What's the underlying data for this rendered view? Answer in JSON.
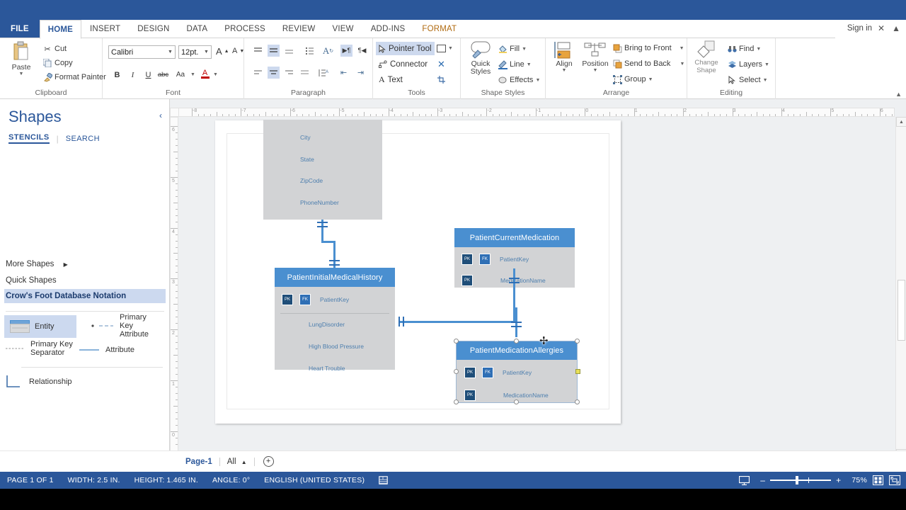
{
  "app": {
    "signin_label": "Sign in"
  },
  "ribbon": {
    "tabs": [
      {
        "label": "FILE",
        "kind": "file"
      },
      {
        "label": "HOME",
        "kind": "active"
      },
      {
        "label": "INSERT",
        "kind": "normal"
      },
      {
        "label": "DESIGN",
        "kind": "normal"
      },
      {
        "label": "DATA",
        "kind": "normal"
      },
      {
        "label": "PROCESS",
        "kind": "normal"
      },
      {
        "label": "REVIEW",
        "kind": "normal"
      },
      {
        "label": "VIEW",
        "kind": "normal"
      },
      {
        "label": "ADD-INS",
        "kind": "normal"
      },
      {
        "label": "FORMAT",
        "kind": "contextual"
      }
    ],
    "groups": {
      "clipboard": {
        "title": "Clipboard",
        "paste": "Paste",
        "cut": "Cut",
        "copy": "Copy",
        "format_painter": "Format Painter"
      },
      "font": {
        "title": "Font",
        "font_name": "Calibri",
        "font_size": "12pt.",
        "grow": "A",
        "shrink": "A",
        "bold": "B",
        "italic": "I",
        "underline": "U",
        "strikethrough": "abc",
        "change_case": "Aa",
        "font_color": "A"
      },
      "paragraph": {
        "title": "Paragraph"
      },
      "tools": {
        "title": "Tools",
        "pointer_tool": "Pointer Tool",
        "connector": "Connector",
        "text": "Text"
      },
      "shape_styles": {
        "title": "Shape Styles",
        "quick_styles": "Quick Styles",
        "fill": "Fill",
        "line": "Line",
        "effects": "Effects"
      },
      "arrange": {
        "title": "Arrange",
        "align": "Align",
        "position": "Position",
        "bring_to_front": "Bring to Front",
        "send_to_back": "Send to Back",
        "group": "Group"
      },
      "editing": {
        "title": "Editing",
        "change_shape": "Change Shape",
        "find": "Find",
        "layers": "Layers",
        "select": "Select"
      }
    }
  },
  "shapes_panel": {
    "title": "Shapes",
    "tabs": [
      {
        "label": "STENCILS",
        "active": true
      },
      {
        "label": "SEARCH",
        "active": false
      }
    ],
    "more_shapes": "More Shapes",
    "quick_shapes": "Quick Shapes",
    "active_stencil": "Crow's Foot Database Notation",
    "masters": [
      {
        "label": "Entity",
        "selected": true
      },
      {
        "label": "Primary Key Attribute",
        "selected": false
      },
      {
        "label": "Primary Key Separator",
        "selected": false
      },
      {
        "label": "Attribute",
        "selected": false
      },
      {
        "label": "Relationship",
        "selected": false
      }
    ]
  },
  "rulers": {
    "horizontal_ticks": [
      "-8",
      "-7",
      "-6",
      "-5",
      "-4",
      "-3",
      "-2",
      "-1",
      "0",
      "1",
      "2",
      "3",
      "4",
      "5",
      "6"
    ],
    "vertical_ticks": [
      "6",
      "5",
      "4",
      "3",
      "2",
      "1",
      "0"
    ]
  },
  "diagram": {
    "entities": [
      {
        "id": "patient-address",
        "title": "",
        "clipped_top": true,
        "attributes": [
          {
            "name": "City",
            "keys": []
          },
          {
            "name": "State",
            "keys": []
          },
          {
            "name": "ZipCode",
            "keys": []
          },
          {
            "name": "PhoneNumber",
            "keys": []
          }
        ]
      },
      {
        "id": "patient-initial-medical-history",
        "title": "PatientInitialMedicalHistory",
        "clipped_top": false,
        "attributes": [
          {
            "name": "PatientKey",
            "keys": [
              "PK",
              "FK"
            ]
          },
          {
            "name": "LungDisorder",
            "keys": []
          },
          {
            "name": "High Blood Pressure",
            "keys": []
          },
          {
            "name": "Heart Trouble",
            "keys": []
          }
        ]
      },
      {
        "id": "patient-current-medication",
        "title": "PatientCurrentMedication",
        "clipped_top": false,
        "attributes": [
          {
            "name": "PatientKey",
            "keys": [
              "PK",
              "FK"
            ]
          },
          {
            "name": "MedicationName",
            "keys": [
              "PK"
            ]
          }
        ]
      },
      {
        "id": "patient-medication-allergies",
        "title": "PatientMedicationAllergies",
        "clipped_top": false,
        "selected": true,
        "attributes": [
          {
            "name": "PatientKey",
            "keys": [
              "PK",
              "FK"
            ]
          },
          {
            "name": "MedicationName",
            "keys": [
              "PK"
            ]
          }
        ]
      }
    ]
  },
  "page_tabs": {
    "page1": "Page-1",
    "all": "All",
    "add_page": "+"
  },
  "status_bar": {
    "page": "PAGE 1 OF 1",
    "width": "WIDTH: 2.5 IN.",
    "height": "HEIGHT: 1.465 IN.",
    "angle": "ANGLE: 0°",
    "language": "ENGLISH (UNITED STATES)",
    "zoom_out": "–",
    "zoom_in": "+",
    "zoom_level": "75%"
  },
  "colors": {
    "brand_blue": "#2b579a",
    "entity_header": "#4a8fd0",
    "entity_body": "#d2d3d5",
    "attr_text": "#4e7fae",
    "pk_badge": "#1f4e79",
    "fk_badge": "#2f6fb5",
    "highlight": "#cdd9ee",
    "contextual_tab": "#b06a10"
  }
}
